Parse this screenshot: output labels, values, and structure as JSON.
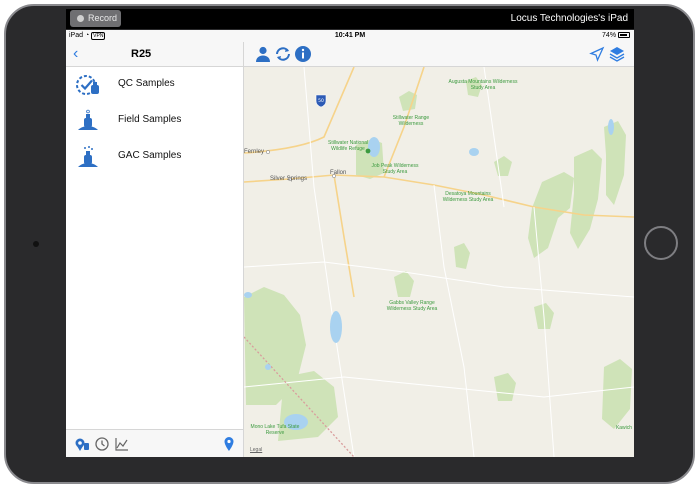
{
  "recorder": {
    "record_label": "Record",
    "device_name": "Locus Technologies's iPad"
  },
  "statusbar": {
    "carrier": "iPad",
    "vpn": "VPN",
    "time": "10:41 PM",
    "battery": "74%"
  },
  "navbar": {
    "title": "R25"
  },
  "sidebar": {
    "items": [
      {
        "label": "QC Samples",
        "icon": "qc-samples-icon"
      },
      {
        "label": "Field Samples",
        "icon": "field-samples-icon"
      },
      {
        "label": "GAC Samples",
        "icon": "gac-samples-icon"
      }
    ]
  },
  "map": {
    "legal": "Legal",
    "highway": "50",
    "places": {
      "fernley": "Fernley",
      "silver_springs": "Silver Springs",
      "fallon": "Fallon",
      "augusta": "Augusta Mountains Wilderness Study Area",
      "stillwater_range": "Stillwater Range Wilderness",
      "stillwater_refuge": "Stillwater National Wildlife Refuge",
      "job_peak": "Job Peak Wilderness Study Area",
      "desatoya": "Desatoya Mountains Wilderness Study Area",
      "gabbs": "Gabbs Valley Range Wilderness Study Area",
      "mono_lake": "Mono Lake Tufa State Reserve",
      "kawich": "Kawich"
    }
  },
  "colors": {
    "accent": "#2f7de1",
    "icon_blue": "#2d6fc4",
    "park_green": "#cfe3b8",
    "road": "#f6d38a",
    "water": "#a9d2f0"
  }
}
